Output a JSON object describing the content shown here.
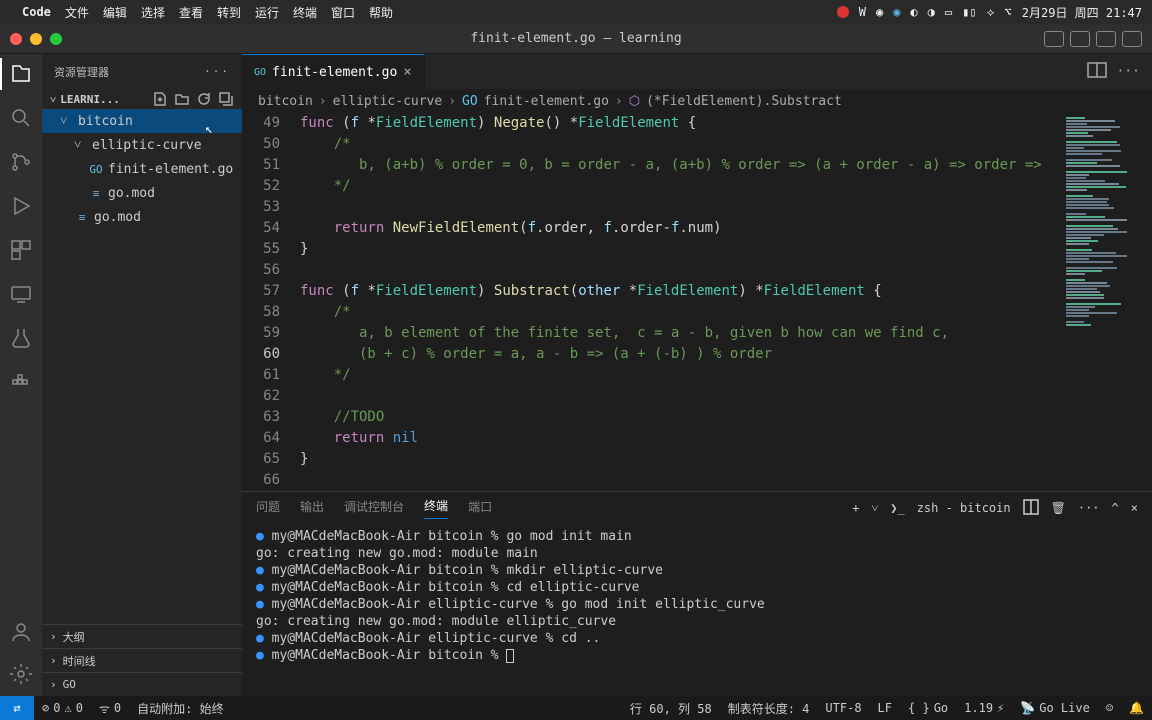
{
  "macmenu": {
    "app": "Code",
    "items": [
      "文件",
      "编辑",
      "选择",
      "查看",
      "转到",
      "运行",
      "终端",
      "窗口",
      "帮助"
    ],
    "clock": "2月29日 周四 21:47"
  },
  "window": {
    "title": "finit-element.go — learning"
  },
  "sidebar": {
    "title": "资源管理器",
    "section": "LEARNI...",
    "tree": {
      "root": "bitcoin",
      "sub": "elliptic-curve",
      "file1": "finit-element.go",
      "file2": "go.mod",
      "file3": "go.mod"
    },
    "outline": "大纲",
    "timeline": "时间线",
    "go": "GO"
  },
  "tabs": {
    "active": "finit-element.go"
  },
  "breadcrumb": {
    "a": "bitcoin",
    "b": "elliptic-curve",
    "c": "finit-element.go",
    "d": "(*FieldElement).Substract"
  },
  "code": {
    "lines": [
      {
        "n": "49",
        "html": "<span class='kw'>func</span> (<span class='pm'>f</span> *<span class='ty'>FieldElement</span>) <span class='fn'>Negate</span>() *<span class='ty'>FieldElement</span> {"
      },
      {
        "n": "50",
        "html": "    <span class='cm'>/*</span>"
      },
      {
        "n": "51",
        "html": "    <span class='cm'>   b, (a+b) % order = 0, b = order - a, (a+b) % order =&gt; (a + order - a) =&gt; order =&gt;</span>"
      },
      {
        "n": "52",
        "html": "    <span class='cm'>*/</span>"
      },
      {
        "n": "53",
        "html": ""
      },
      {
        "n": "54",
        "html": "    <span class='kw'>return</span> <span class='fn'>NewFieldElement</span>(<span class='pm'>f</span>.order, <span class='pm'>f</span>.order-<span class='pm'>f</span>.num)"
      },
      {
        "n": "55",
        "html": "}"
      },
      {
        "n": "56",
        "html": ""
      },
      {
        "n": "57",
        "html": "<span class='kw'>func</span> (<span class='pm'>f</span> *<span class='ty'>FieldElement</span>) <span class='fn'>Substract</span>(<span class='pm'>other</span> *<span class='ty'>FieldElement</span>) *<span class='ty'>FieldElement</span> {"
      },
      {
        "n": "58",
        "html": "    <span class='cm'>/*</span>"
      },
      {
        "n": "59",
        "html": "    <span class='cm'>   a, b element of the finite set,  c = a - b, given b how can we find c,</span>"
      },
      {
        "n": "60",
        "html": "    <span class='cm'>   (b + c) % order = a, a - b =&gt; (a + (-b) ) % order </span>",
        "cur": true
      },
      {
        "n": "61",
        "html": "    <span class='cm'>*/</span>"
      },
      {
        "n": "62",
        "html": ""
      },
      {
        "n": "63",
        "html": "    <span class='cm'>//TODO</span>"
      },
      {
        "n": "64",
        "html": "    <span class='kw'>return</span> <span class='nil'>nil</span>"
      },
      {
        "n": "65",
        "html": "}"
      },
      {
        "n": "66",
        "html": ""
      }
    ]
  },
  "panel": {
    "tabs": {
      "problems": "问题",
      "output": "输出",
      "debug": "调试控制台",
      "terminal": "终端",
      "ports": "端口"
    },
    "shell": "zsh - bitcoin",
    "lines": [
      {
        "b": true,
        "t": "my@MACdeMacBook-Air bitcoin % go mod init main"
      },
      {
        "b": false,
        "t": "go: creating new go.mod: module main"
      },
      {
        "b": true,
        "t": "my@MACdeMacBook-Air bitcoin % mkdir elliptic-curve"
      },
      {
        "b": true,
        "t": "my@MACdeMacBook-Air bitcoin % cd elliptic-curve"
      },
      {
        "b": true,
        "t": "my@MACdeMacBook-Air elliptic-curve % go mod init elliptic_curve"
      },
      {
        "b": false,
        "t": "go: creating new go.mod: module elliptic_curve"
      },
      {
        "b": true,
        "t": "my@MACdeMacBook-Air elliptic-curve % cd .."
      },
      {
        "b": true,
        "t": "my@MACdeMacBook-Air bitcoin % ",
        "cursor": true
      }
    ]
  },
  "status": {
    "err": "0",
    "warn": "0",
    "port": "0",
    "attach": "自动附加: 始终",
    "pos": "行 60, 列 58",
    "tab": "制表符长度: 4",
    "enc": "UTF-8",
    "eol": "LF",
    "lang": "Go",
    "ver": "1.19",
    "golive": "Go Live"
  }
}
